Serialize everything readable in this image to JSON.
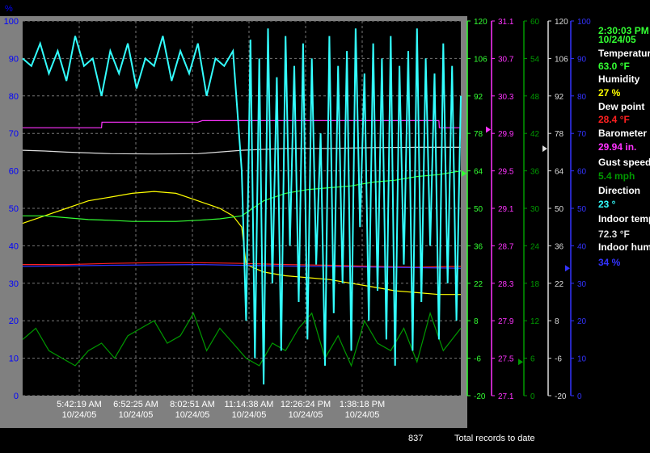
{
  "readout": {
    "time": "2:30:03 PM",
    "date": "10/24/05",
    "items": [
      {
        "label": "Temperature",
        "value": "63.0 °F",
        "color": "#33ff33"
      },
      {
        "label": "Humidity",
        "value": "27 %",
        "color": "#ffff00"
      },
      {
        "label": "Dew point",
        "value": "28.4 °F",
        "color": "#ff2020"
      },
      {
        "label": "Barometer",
        "value": "29.94 in.",
        "color": "#ff33ff"
      },
      {
        "label": "Gust speed",
        "value": "5.4 mph",
        "color": "#009900"
      },
      {
        "label": "Direction",
        "value": "23 °",
        "color": "#33ffff"
      },
      {
        "label": "Indoor temp",
        "value": "72.3 °F",
        "color": "#dddddd"
      },
      {
        "label": "Indoor hum",
        "value": "34 %",
        "color": "#3333ff"
      }
    ]
  },
  "footer": {
    "count": "837",
    "text": "Total records to date"
  },
  "chart_data": {
    "type": "line",
    "left_axis": {
      "unit": "%",
      "min": 0,
      "max": 100,
      "ticks": [
        "0",
        "10",
        "20",
        "30",
        "40",
        "50",
        "60",
        "70",
        "80",
        "90",
        "100"
      ]
    },
    "x_ticks": [
      {
        "time": "5:42:19 AM",
        "date": "10/24/05"
      },
      {
        "time": "6:52:25 AM",
        "date": "10/24/05"
      },
      {
        "time": "8:02:51 AM",
        "date": "10/24/05"
      },
      {
        "time": "11:14:38 AM",
        "date": "10/24/05"
      },
      {
        "time": "12:26:24 PM",
        "date": "10/24/05"
      },
      {
        "time": "1:38:18 PM",
        "date": "10/24/05"
      }
    ],
    "right_axes": [
      {
        "name": "temperature",
        "color": "#33ff33",
        "marker": 63.0,
        "ticks": [
          "-20",
          "-6",
          "8",
          "22",
          "36",
          "50",
          "64",
          "78",
          "92",
          "106",
          "120"
        ]
      },
      {
        "name": "barometer",
        "color": "#ff33ff",
        "marker": 29.94,
        "ticks": [
          "27.1",
          "27.5",
          "27.9",
          "28.3",
          "28.7",
          "29.1",
          "29.5",
          "29.9",
          "30.3",
          "30.7",
          "31.1"
        ]
      },
      {
        "name": "gust",
        "color": "#009900",
        "marker": 5.4,
        "ticks": [
          "0",
          "6",
          "12",
          "18",
          "24",
          "30",
          "36",
          "42",
          "48",
          "54",
          "60"
        ]
      },
      {
        "name": "indoor-temp",
        "color": "#dddddd",
        "marker": 72.3,
        "ticks": [
          "-20",
          "-6",
          "8",
          "22",
          "36",
          "50",
          "64",
          "78",
          "92",
          "106",
          "120"
        ]
      },
      {
        "name": "indoor-hum",
        "color": "#3333ff",
        "marker": 34,
        "ticks": [
          "0",
          "10",
          "20",
          "30",
          "40",
          "50",
          "60",
          "70",
          "80",
          "90",
          "100"
        ]
      }
    ],
    "series": [
      {
        "name": "Indoor temp",
        "color": "#dddddd",
        "x": [
          0,
          0.05,
          0.1,
          0.2,
          0.3,
          0.4,
          0.5,
          0.6,
          0.7,
          0.8,
          0.9,
          1
        ],
        "y": [
          65.5,
          65.3,
          65,
          64.6,
          64.5,
          64.6,
          65.5,
          66,
          66,
          66.2,
          66.3,
          66.3
        ]
      },
      {
        "name": "Barometer",
        "color": "#ff33ff",
        "x": [
          0,
          0.18,
          0.181,
          0.4,
          0.41,
          0.9,
          0.95,
          0.951,
          1
        ],
        "y": [
          71.5,
          71.5,
          73,
          73,
          73.4,
          73.4,
          73.4,
          71.5,
          71.5
        ]
      },
      {
        "name": "Humidity",
        "color": "#ffff00",
        "x": [
          0,
          0.05,
          0.1,
          0.15,
          0.2,
          0.25,
          0.3,
          0.35,
          0.4,
          0.45,
          0.48,
          0.5,
          0.51,
          0.55,
          0.6,
          0.65,
          0.7,
          0.75,
          0.8,
          0.85,
          0.9,
          0.95,
          1
        ],
        "y": [
          46,
          48,
          50,
          52,
          53,
          54,
          54.5,
          54,
          52,
          50,
          48,
          45,
          35,
          33,
          32,
          31.5,
          31,
          30,
          29,
          28,
          27.5,
          27,
          27
        ]
      },
      {
        "name": "Temperature",
        "color": "#33ff33",
        "x": [
          0,
          0.05,
          0.1,
          0.15,
          0.2,
          0.25,
          0.3,
          0.35,
          0.4,
          0.45,
          0.5,
          0.55,
          0.6,
          0.65,
          0.7,
          0.75,
          0.8,
          0.85,
          0.9,
          0.95,
          1
        ],
        "y": [
          48,
          48,
          47.5,
          47,
          46.8,
          46.5,
          46.5,
          46.5,
          46.8,
          47.2,
          48,
          52,
          54,
          55,
          55.5,
          56,
          57,
          57.5,
          58.5,
          59,
          60
        ]
      },
      {
        "name": "Dew point",
        "color": "#ff2020",
        "x": [
          0,
          0.1,
          0.2,
          0.3,
          0.4,
          0.5,
          0.6,
          0.7,
          0.8,
          0.9,
          1
        ],
        "y": [
          35,
          35,
          35.3,
          35.5,
          35.5,
          35.3,
          35,
          34.8,
          34.5,
          34.3,
          34.5
        ]
      },
      {
        "name": "Indoor hum",
        "color": "#3333ff",
        "x": [
          0,
          0.2,
          0.4,
          0.6,
          0.8,
          1
        ],
        "y": [
          34.5,
          34.8,
          35,
          34.6,
          34.3,
          34
        ]
      },
      {
        "name": "Gust speed",
        "color": "#009900",
        "x": [
          0,
          0.03,
          0.06,
          0.09,
          0.12,
          0.15,
          0.18,
          0.21,
          0.24,
          0.27,
          0.3,
          0.33,
          0.36,
          0.39,
          0.42,
          0.45,
          0.48,
          0.51,
          0.54,
          0.57,
          0.6,
          0.63,
          0.66,
          0.69,
          0.72,
          0.75,
          0.78,
          0.81,
          0.84,
          0.87,
          0.9,
          0.93,
          0.96,
          1
        ],
        "y": [
          15,
          18,
          12,
          10,
          8,
          12,
          14,
          10,
          16,
          18,
          20,
          14,
          16,
          22,
          12,
          18,
          14,
          10,
          8,
          14,
          12,
          18,
          22,
          10,
          16,
          8,
          20,
          14,
          12,
          18,
          9,
          22,
          12,
          18
        ]
      },
      {
        "name": "Direction",
        "color": "#33ffff",
        "x": [
          0,
          0.02,
          0.04,
          0.06,
          0.08,
          0.1,
          0.12,
          0.14,
          0.16,
          0.18,
          0.2,
          0.22,
          0.24,
          0.26,
          0.28,
          0.3,
          0.32,
          0.34,
          0.36,
          0.38,
          0.4,
          0.42,
          0.44,
          0.46,
          0.48,
          0.5,
          0.51,
          0.52,
          0.53,
          0.54,
          0.55,
          0.56,
          0.57,
          0.58,
          0.59,
          0.6,
          0.61,
          0.62,
          0.63,
          0.64,
          0.65,
          0.66,
          0.67,
          0.68,
          0.69,
          0.7,
          0.71,
          0.72,
          0.73,
          0.74,
          0.75,
          0.76,
          0.77,
          0.78,
          0.79,
          0.8,
          0.81,
          0.82,
          0.83,
          0.84,
          0.85,
          0.86,
          0.87,
          0.88,
          0.89,
          0.9,
          0.91,
          0.92,
          0.93,
          0.94,
          0.95,
          0.96,
          0.97,
          0.98,
          0.99,
          1
        ],
        "y": [
          90,
          88,
          94,
          86,
          92,
          84,
          96,
          88,
          90,
          80,
          92,
          86,
          94,
          82,
          90,
          88,
          96,
          84,
          92,
          86,
          94,
          80,
          90,
          88,
          92,
          60,
          20,
          95,
          10,
          90,
          3,
          98,
          30,
          85,
          12,
          96,
          40,
          88,
          25,
          94,
          15,
          90,
          35,
          70,
          8,
          96,
          22,
          88,
          30,
          92,
          12,
          98,
          45,
          86,
          20,
          94,
          28,
          90,
          15,
          96,
          8,
          88,
          35,
          92,
          12,
          98,
          25,
          90,
          40,
          86,
          15,
          94,
          30,
          88,
          20,
          80
        ]
      }
    ]
  }
}
